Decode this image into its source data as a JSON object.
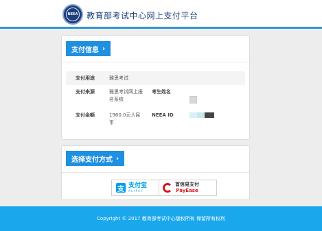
{
  "header": {
    "logo_text": "NEEA",
    "title": "教育部考试中心网上支付平台"
  },
  "payment_info": {
    "section_title": "支付信息",
    "chevron": "›",
    "rows": [
      {
        "label": "支付用途",
        "value": "雅思考试"
      },
      {
        "label": "支付来源",
        "value": "雅思考试网上报名系统"
      },
      {
        "label": "支付金额",
        "value": "1960.0元人民币"
      }
    ],
    "candidate_name_label": "考生姓名",
    "neea_id_label": "NEEA ID"
  },
  "payment_method": {
    "section_title": "选择支付方式",
    "chevron": "›",
    "alipay": {
      "cn": "支付宝",
      "en": "ALIPAY",
      "icon": "alipay-icon",
      "icon_glyph": "支"
    },
    "payease": {
      "cn": "首信易支付",
      "en": "PayEase",
      "icon": "payease-icon"
    }
  },
  "footer": {
    "text": "Copyright © 2017 教育部考试中心版权所有 保留所有权利"
  },
  "colors": {
    "accent": "#1f8fe0",
    "footer": "#1aa7ec",
    "brand": "#1d3f7c",
    "payease_red": "#d7161e"
  }
}
